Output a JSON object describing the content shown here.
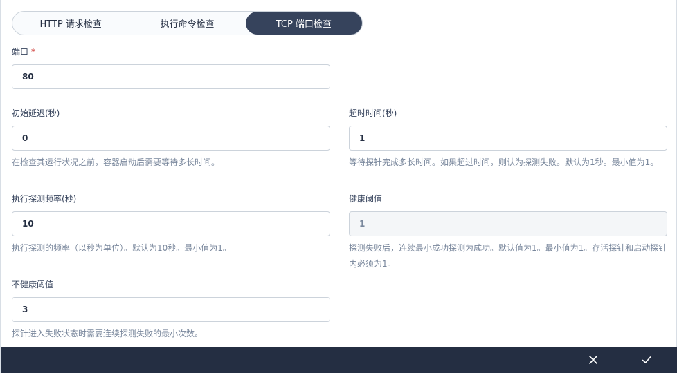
{
  "tabs": [
    {
      "label": "HTTP 请求检查",
      "active": false
    },
    {
      "label": "执行命令检查",
      "active": false
    },
    {
      "label": "TCP 端口检查",
      "active": true
    }
  ],
  "port": {
    "label": "端口",
    "required_mark": "*",
    "value": "80"
  },
  "initial_delay": {
    "label": "初始延迟(秒)",
    "value": "0",
    "description": "在检查其运行状况之前，容器启动后需要等待多长时间。"
  },
  "timeout": {
    "label": "超时时间(秒)",
    "value": "1",
    "description": "等待探针完成多长时间。如果超过时间，则认为探测失败。默认为1秒。最小值为1。"
  },
  "period": {
    "label": "执行探测频率(秒)",
    "value": "10",
    "description": "执行探测的频率（以秒为单位）。默认为10秒。最小值为1。"
  },
  "success_threshold": {
    "label": "健康阈值",
    "value": "1",
    "disabled": true,
    "description": "探测失败后，连续最小成功探测为成功。默认值为1。最小值为1。存活探针和启动探针内必须为1。"
  },
  "failure_threshold": {
    "label": "不健康阈值",
    "value": "3",
    "description": "探针进入失败状态时需要连续探测失败的最小次数。"
  },
  "footer": {
    "cancel_icon": "close-icon",
    "confirm_icon": "check-icon"
  },
  "colors": {
    "accent": "#36435c",
    "footer_bg": "#242e42",
    "required": "#ca2621",
    "muted_text": "#79879c",
    "border": "#ccd3db"
  }
}
